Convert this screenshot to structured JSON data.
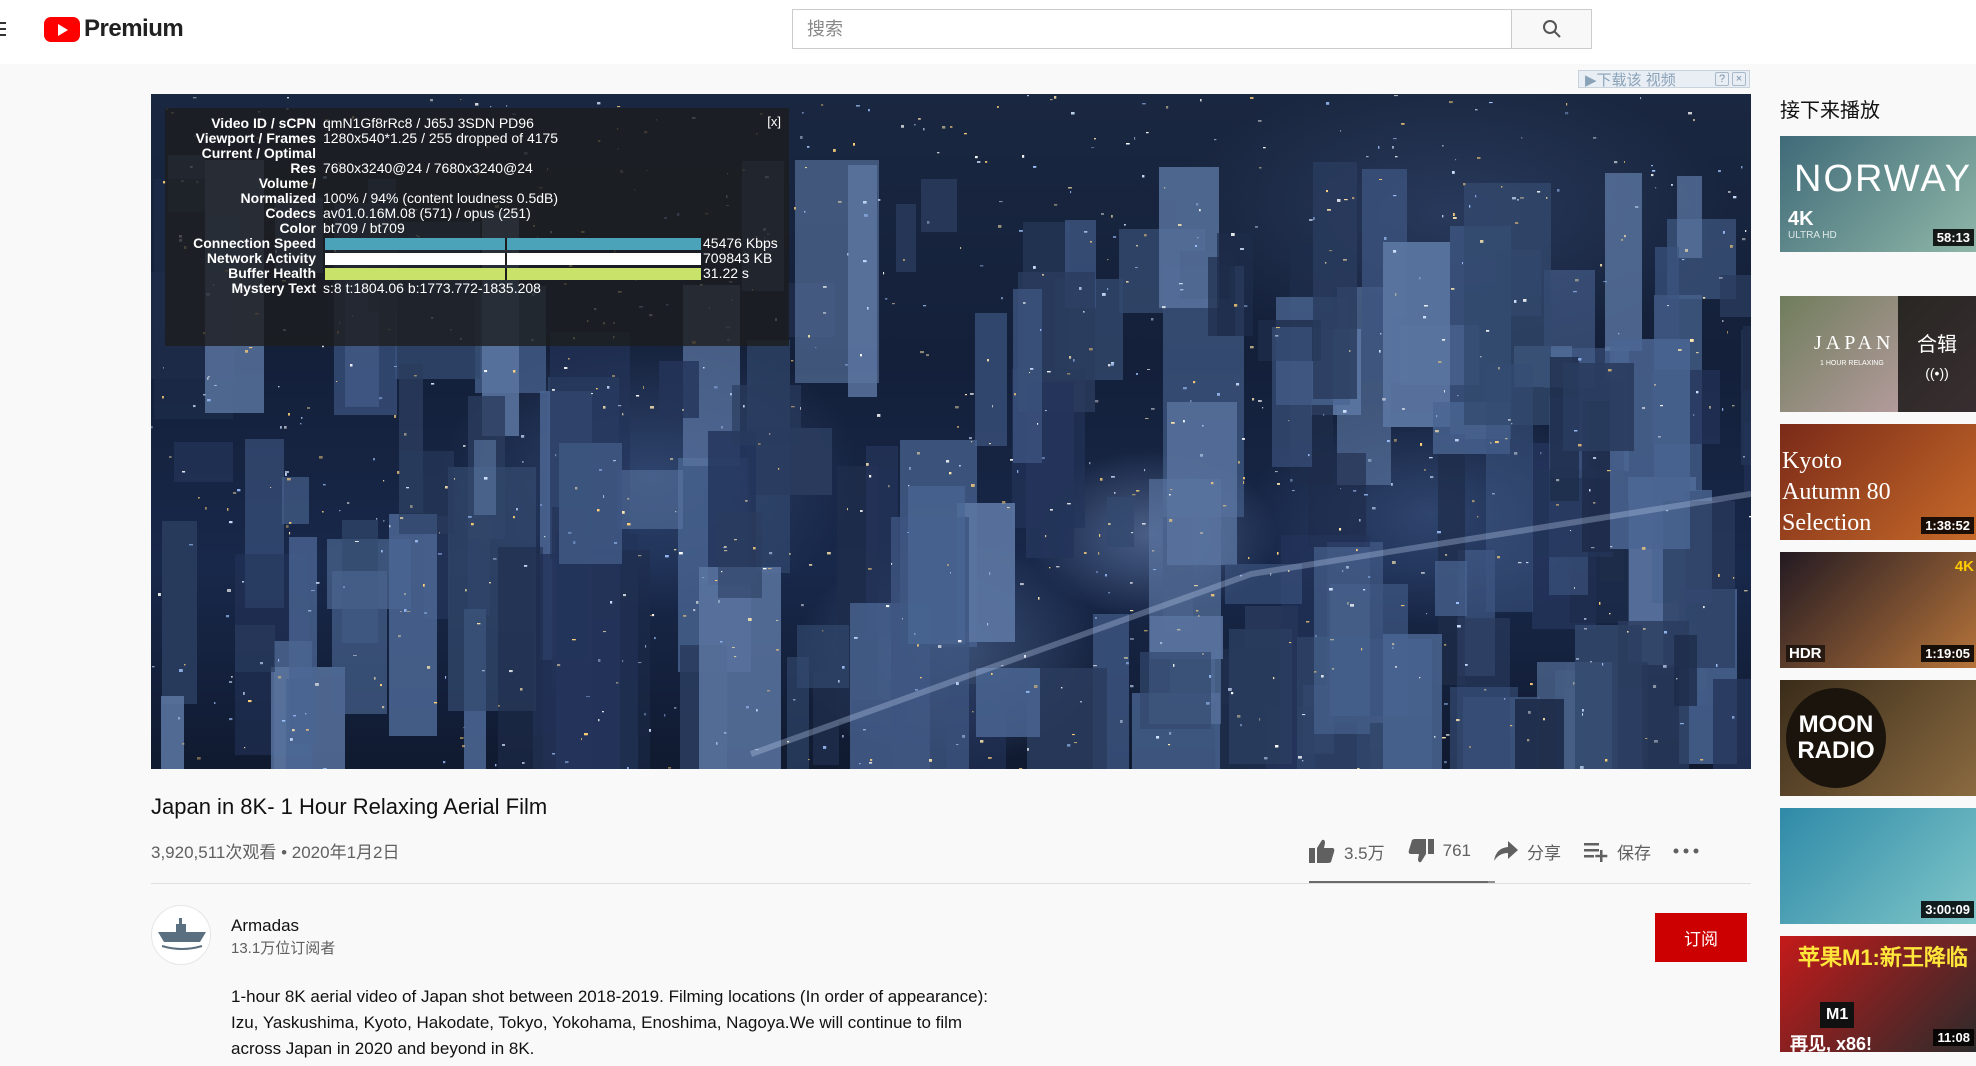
{
  "header": {
    "logo_text": "Premium",
    "search_placeholder": "搜索"
  },
  "download_bar": {
    "label": "▶下载该 视频",
    "help": "?",
    "close": "×"
  },
  "player": {
    "stats": {
      "close": "[x]",
      "rows": [
        {
          "key": "Video ID / sCPN",
          "value": "qmN1Gf8rRc8 / J65J 3SDN PD96"
        },
        {
          "key": "Viewport / Frames",
          "value": "1280x540*1.25 / 255 dropped of 4175"
        },
        {
          "key": "Current / Optimal",
          "value": ""
        },
        {
          "key": "Res",
          "value": "7680x3240@24 / 7680x3240@24"
        },
        {
          "key": "Volume /",
          "value": ""
        },
        {
          "key": "Normalized",
          "value": "100% / 94% (content loudness 0.5dB)"
        },
        {
          "key": "Codecs",
          "value": "av01.0.16M.08 (571) / opus (251)"
        },
        {
          "key": "Color",
          "value": "bt709 / bt709"
        },
        {
          "key": "Connection Speed",
          "value": "45476 Kbps",
          "bar_color": "#4aa3b8",
          "bar_fill": 1.0
        },
        {
          "key": "Network Activity",
          "value": "709843 KB",
          "bar_color": "#ffffff",
          "bar_fill": 1.0
        },
        {
          "key": "Buffer Health",
          "value": "31.22 s",
          "bar_color": "#c9e26a",
          "bar_fill": 1.0
        },
        {
          "key": "Mystery Text",
          "value": "s:8 t:1804.06 b:1773.772-1835.208"
        }
      ]
    }
  },
  "video": {
    "title": "Japan in 8K- 1 Hour Relaxing Aerial Film",
    "meta": "3,920,511次观看 • 2020年1月2日",
    "likes": "3.5万",
    "dislikes": "761",
    "share_label": "分享",
    "save_label": "保存",
    "like_ratio": 0.96
  },
  "channel": {
    "name": "Armadas",
    "subscribers": "13.1万位订阅者",
    "subscribe_label": "订阅"
  },
  "description": "1-hour 8K aerial video of Japan shot between 2018-2019. Filming locations (In order of appearance): Izu, Yaskushima, Kyoto, Hakodate, Tokyo, Yokohama, Enoshima, Nagoya.We will continue to film across Japan in 2020 and beyond in 8K.",
  "sidebar": {
    "heading": "接下来播放",
    "items": [
      {
        "duration": "58:13",
        "overlay": "NORWAY",
        "badge": "4K",
        "sub": "ULTRA HD",
        "colors": [
          "#3f6a78",
          "#8fb7a8"
        ]
      },
      {
        "overlay": "JAPAN",
        "sub": "1 HOUR RELAXING",
        "mix_label": "合辑",
        "mix_icon": "((•))",
        "colors": [
          "#6f7d5c",
          "#c9a4b0"
        ]
      },
      {
        "duration": "1:38:52",
        "overlay": "Kyoto Autumn 80 Selection",
        "colors": [
          "#7a2a18",
          "#c66a2a"
        ]
      },
      {
        "duration": "1:19:05",
        "badge": "HDR",
        "corner": "4K",
        "colors": [
          "#231a22",
          "#b6743a"
        ]
      },
      {
        "overlay": "MOON RADIO",
        "colors": [
          "#3a2c1a",
          "#8a6a40"
        ]
      },
      {
        "duration": "3:00:09",
        "colors": [
          "#2f8aa8",
          "#7fc6c8"
        ]
      },
      {
        "duration": "11:08",
        "overlay": "苹果M1:新王降临",
        "sub": "再见, x86!",
        "chip": "M1",
        "colors": [
          "#c41a1a",
          "#2b2b2b"
        ]
      }
    ]
  }
}
